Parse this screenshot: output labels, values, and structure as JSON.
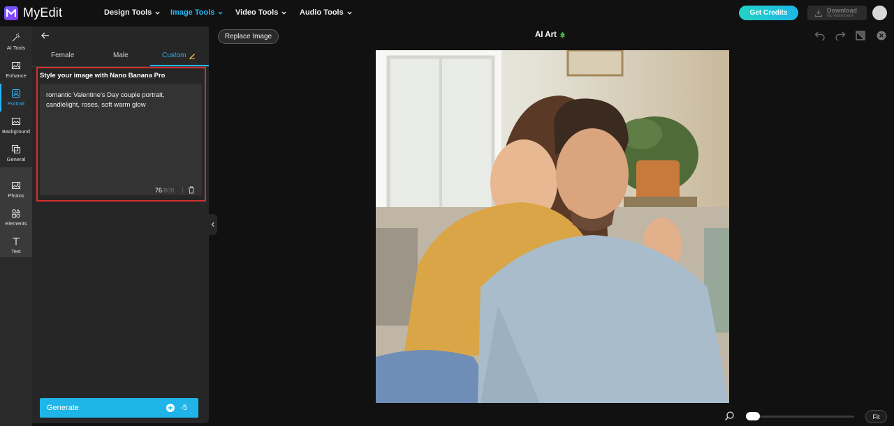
{
  "app": {
    "name": "MyEdit"
  },
  "nav": [
    {
      "label": "Design Tools",
      "active": false
    },
    {
      "label": "Image Tools",
      "active": true
    },
    {
      "label": "Video Tools",
      "active": false
    },
    {
      "label": "Audio Tools",
      "active": false
    }
  ],
  "header": {
    "get_credits": "Get Credits",
    "download_label": "Download",
    "download_sub": "No Watermark"
  },
  "rail": [
    {
      "label": "AI Tools",
      "icon": "magic-wand-icon"
    },
    {
      "label": "Enhance",
      "icon": "image-enhance-icon"
    },
    {
      "label": "Portrait",
      "icon": "portrait-icon",
      "active": true
    },
    {
      "label": "Background",
      "icon": "background-icon"
    },
    {
      "label": "General",
      "icon": "general-icon"
    },
    {
      "label": "Photos",
      "icon": "photos-icon"
    },
    {
      "label": "Elements",
      "icon": "elements-icon"
    },
    {
      "label": "Text",
      "icon": "text-icon"
    }
  ],
  "panel": {
    "tabs": [
      {
        "label": "Female"
      },
      {
        "label": "Male"
      },
      {
        "label": "Custom"
      }
    ],
    "style_title": "Style your image with Nano Banana Pro",
    "prompt": "romantic Valentine's Day couple portrait, candlelight, roses, soft warm glow",
    "char_count": "76",
    "char_max": "/800",
    "generate_label": "Generate",
    "generate_cost": "-5"
  },
  "canvas": {
    "replace_image": "Replace Image",
    "title": "AI Art",
    "fit_label": "Fit"
  },
  "colors": {
    "accent": "#29b6f6",
    "highlight_border": "#d32f2f",
    "generate_bg": "#1fb5e8"
  }
}
